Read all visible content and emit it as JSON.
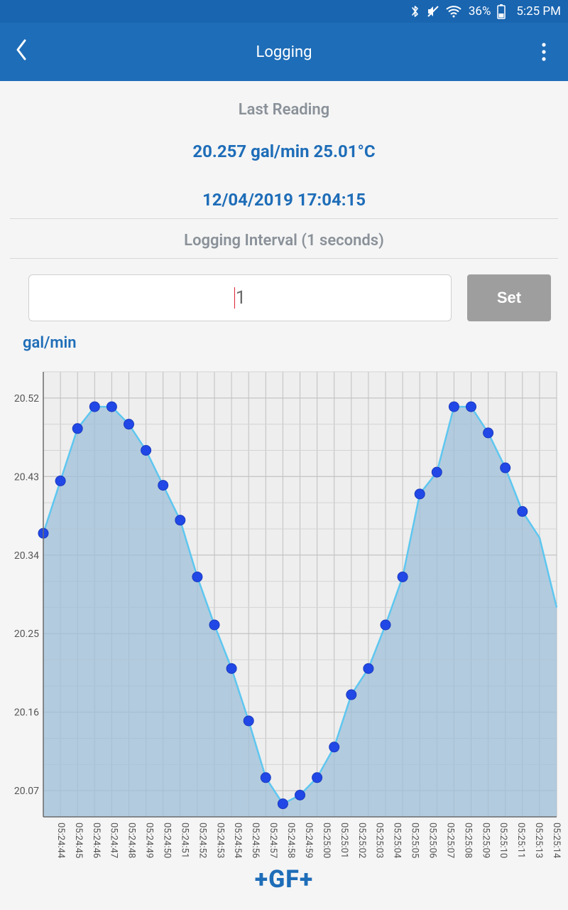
{
  "status": {
    "battery_pct": "36%",
    "clock": "5:25 PM"
  },
  "header": {
    "title": "Logging"
  },
  "reading": {
    "label": "Last Reading",
    "value": "20.257 gal/min 25.01°C",
    "timestamp": "12/04/2019 17:04:15"
  },
  "interval": {
    "label": "Logging Interval (1 seconds)",
    "value": "1",
    "set_label": "Set"
  },
  "chart": {
    "unit": "gal/min"
  },
  "chart_data": {
    "type": "area",
    "title": "",
    "xlabel": "",
    "ylabel": "gal/min",
    "ylim": [
      20.04,
      20.55
    ],
    "y_ticks": [
      20.07,
      20.16,
      20.25,
      20.34,
      20.43,
      20.52
    ],
    "categories": [
      "05:24:44",
      "05:24:45",
      "05:24:46",
      "05:24:47",
      "05:24:48",
      "05:24:49",
      "05:24:50",
      "05:24:51",
      "05:24:52",
      "05:24:53",
      "05:24:54",
      "05:24:56",
      "05:24:57",
      "05:24:58",
      "05:24:59",
      "05:25:00",
      "05:25:01",
      "05:25:02",
      "05:25:03",
      "05:25:04",
      "05:25:05",
      "05:25:06",
      "05:25:07",
      "05:25:08",
      "05:25:09",
      "05:25:10",
      "05:25:11",
      "05:25:13",
      "05:25:14"
    ],
    "values": [
      20.365,
      20.425,
      20.485,
      20.51,
      20.51,
      20.49,
      20.46,
      20.42,
      20.38,
      20.315,
      20.26,
      20.21,
      20.15,
      20.085,
      20.055,
      20.065,
      20.085,
      20.12,
      20.18,
      20.21,
      20.26,
      20.315,
      20.41,
      20.435,
      20.51,
      20.51,
      20.48,
      20.44,
      20.39,
      20.36,
      20.28
    ]
  },
  "footer": {
    "logo": "+GF+"
  }
}
